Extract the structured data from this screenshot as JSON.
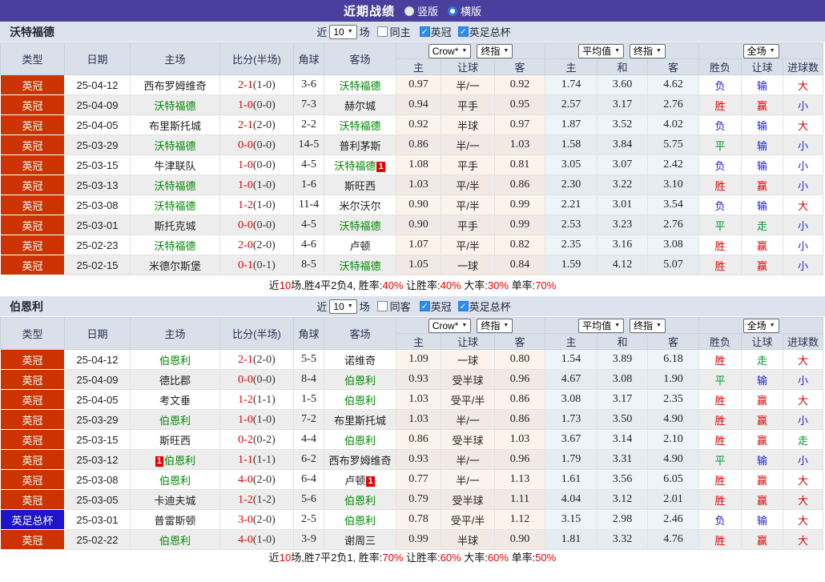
{
  "topbar": {
    "title": "近期战绩",
    "radio_vertical": "竖版",
    "radio_horizontal": "横版"
  },
  "head": {
    "cols": [
      "类型",
      "日期",
      "主场",
      "比分(半场)",
      "角球",
      "客场"
    ],
    "selects": {
      "book": "Crow*",
      "final_a": "终指",
      "avg": "平均值",
      "final_b": "终指",
      "scope": "全场"
    },
    "sub": [
      "主",
      "让球",
      "客",
      "主",
      "和",
      "客",
      "胜负",
      "让球",
      "进球数"
    ]
  },
  "type_colors": {
    "英冠": "#cc3300",
    "英足总杯": "#1f14cc"
  },
  "result_colors": {
    "胜": "#e60000",
    "赢": "#e60000",
    "大": "#e60000",
    "负": "#2222cc",
    "输": "#2222cc",
    "小": "#2222cc",
    "平": "#009933",
    "走": "#009933"
  },
  "colors": {
    "topbar_bg": "#4a3f9d",
    "section_bg": "#dce3ee",
    "header_bg": "#d9e0ea",
    "team_green": "#008800",
    "score_red": "#e60000",
    "badge_red": "#e60000",
    "check_blue": "#2b8ced"
  },
  "sections": [
    {
      "team": "沃特福德",
      "filter": {
        "near": "近",
        "count": "10",
        "games": "场",
        "same": {
          "label": "同主",
          "checked": false
        },
        "checks": [
          {
            "label": "英冠",
            "checked": true
          },
          {
            "label": "英足总杯",
            "checked": true
          }
        ]
      },
      "rows": [
        {
          "type": "英冠",
          "date": "25-04-12",
          "home": "西布罗姆维奇",
          "home_badge": "",
          "score": "2-1",
          "half": "(1-0)",
          "corner": "3-6",
          "away": "沃特福德",
          "away_badge": "",
          "odds": [
            "0.97",
            "半/一",
            "0.92"
          ],
          "avg": [
            "1.74",
            "3.60",
            "4.62"
          ],
          "result": [
            "负",
            "输",
            "大"
          ]
        },
        {
          "type": "英冠",
          "date": "25-04-09",
          "home": "沃特福德",
          "home_badge": "",
          "score": "1-0",
          "half": "(0-0)",
          "corner": "7-3",
          "away": "赫尔城",
          "away_badge": "",
          "odds": [
            "0.94",
            "平手",
            "0.95"
          ],
          "avg": [
            "2.57",
            "3.17",
            "2.76"
          ],
          "result": [
            "胜",
            "赢",
            "小"
          ]
        },
        {
          "type": "英冠",
          "date": "25-04-05",
          "home": "布里斯托城",
          "home_badge": "",
          "score": "2-1",
          "half": "(2-0)",
          "corner": "2-2",
          "away": "沃特福德",
          "away_badge": "",
          "odds": [
            "0.92",
            "半球",
            "0.97"
          ],
          "avg": [
            "1.87",
            "3.52",
            "4.02"
          ],
          "result": [
            "负",
            "输",
            "大"
          ]
        },
        {
          "type": "英冠",
          "date": "25-03-29",
          "home": "沃特福德",
          "home_badge": "",
          "score": "0-0",
          "half": "(0-0)",
          "corner": "14-5",
          "away": "普利茅斯",
          "away_badge": "",
          "odds": [
            "0.86",
            "半/一",
            "1.03"
          ],
          "avg": [
            "1.58",
            "3.84",
            "5.75"
          ],
          "result": [
            "平",
            "输",
            "小"
          ]
        },
        {
          "type": "英冠",
          "date": "25-03-15",
          "home": "牛津联队",
          "home_badge": "",
          "score": "1-0",
          "half": "(0-0)",
          "corner": "4-5",
          "away": "沃特福德",
          "away_badge": "1",
          "odds": [
            "1.08",
            "平手",
            "0.81"
          ],
          "avg": [
            "3.05",
            "3.07",
            "2.42"
          ],
          "result": [
            "负",
            "输",
            "小"
          ]
        },
        {
          "type": "英冠",
          "date": "25-03-13",
          "home": "沃特福德",
          "home_badge": "",
          "score": "1-0",
          "half": "(1-0)",
          "corner": "1-6",
          "away": "斯旺西",
          "away_badge": "",
          "odds": [
            "1.03",
            "平/半",
            "0.86"
          ],
          "avg": [
            "2.30",
            "3.22",
            "3.10"
          ],
          "result": [
            "胜",
            "赢",
            "小"
          ]
        },
        {
          "type": "英冠",
          "date": "25-03-08",
          "home": "沃特福德",
          "home_badge": "",
          "score": "1-2",
          "half": "(1-0)",
          "corner": "11-4",
          "away": "米尔沃尔",
          "away_badge": "",
          "odds": [
            "0.90",
            "平/半",
            "0.99"
          ],
          "avg": [
            "2.21",
            "3.01",
            "3.54"
          ],
          "result": [
            "负",
            "输",
            "大"
          ]
        },
        {
          "type": "英冠",
          "date": "25-03-01",
          "home": "斯托克城",
          "home_badge": "",
          "score": "0-0",
          "half": "(0-0)",
          "corner": "4-5",
          "away": "沃特福德",
          "away_badge": "",
          "odds": [
            "0.90",
            "平手",
            "0.99"
          ],
          "avg": [
            "2.53",
            "3.23",
            "2.76"
          ],
          "result": [
            "平",
            "走",
            "小"
          ]
        },
        {
          "type": "英冠",
          "date": "25-02-23",
          "home": "沃特福德",
          "home_badge": "",
          "score": "2-0",
          "half": "(2-0)",
          "corner": "4-6",
          "away": "卢顿",
          "away_badge": "",
          "odds": [
            "1.07",
            "平/半",
            "0.82"
          ],
          "avg": [
            "2.35",
            "3.16",
            "3.08"
          ],
          "result": [
            "胜",
            "赢",
            "小"
          ]
        },
        {
          "type": "英冠",
          "date": "25-02-15",
          "home": "米德尔斯堡",
          "home_badge": "",
          "score": "0-1",
          "half": "(0-1)",
          "corner": "8-5",
          "away": "沃特福德",
          "away_badge": "",
          "odds": [
            "1.05",
            "一球",
            "0.84"
          ],
          "avg": [
            "1.59",
            "4.12",
            "5.07"
          ],
          "result": [
            "胜",
            "赢",
            "小"
          ]
        }
      ],
      "summary": [
        {
          "t": "近"
        },
        {
          "t": "10",
          "red": true
        },
        {
          "t": "场,胜4平2负4, 胜率:"
        },
        {
          "t": "40%",
          "red": true
        },
        {
          "t": " 让胜率:"
        },
        {
          "t": "40%",
          "red": true
        },
        {
          "t": " 大率:"
        },
        {
          "t": "30%",
          "red": true
        },
        {
          "t": " 单率:"
        },
        {
          "t": "70%",
          "red": true
        }
      ]
    },
    {
      "team": "伯恩利",
      "filter": {
        "near": "近",
        "count": "10",
        "games": "场",
        "same": {
          "label": "同客",
          "checked": false
        },
        "checks": [
          {
            "label": "英冠",
            "checked": true
          },
          {
            "label": "英足总杯",
            "checked": true
          }
        ]
      },
      "rows": [
        {
          "type": "英冠",
          "date": "25-04-12",
          "home": "伯恩利",
          "home_badge": "",
          "score": "2-1",
          "half": "(2-0)",
          "corner": "5-5",
          "away": "诺维奇",
          "away_badge": "",
          "odds": [
            "1.09",
            "一球",
            "0.80"
          ],
          "avg": [
            "1.54",
            "3.89",
            "6.18"
          ],
          "result": [
            "胜",
            "走",
            "大"
          ]
        },
        {
          "type": "英冠",
          "date": "25-04-09",
          "home": "德比郡",
          "home_badge": "",
          "score": "0-0",
          "half": "(0-0)",
          "corner": "8-4",
          "away": "伯恩利",
          "away_badge": "",
          "odds": [
            "0.93",
            "受半球",
            "0.96"
          ],
          "avg": [
            "4.67",
            "3.08",
            "1.90"
          ],
          "result": [
            "平",
            "输",
            "小"
          ]
        },
        {
          "type": "英冠",
          "date": "25-04-05",
          "home": "考文垂",
          "home_badge": "",
          "score": "1-2",
          "half": "(1-1)",
          "corner": "1-5",
          "away": "伯恩利",
          "away_badge": "",
          "odds": [
            "1.03",
            "受平/半",
            "0.86"
          ],
          "avg": [
            "3.08",
            "3.17",
            "2.35"
          ],
          "result": [
            "胜",
            "赢",
            "大"
          ]
        },
        {
          "type": "英冠",
          "date": "25-03-29",
          "home": "伯恩利",
          "home_badge": "",
          "score": "1-0",
          "half": "(1-0)",
          "corner": "7-2",
          "away": "布里斯托城",
          "away_badge": "",
          "odds": [
            "1.03",
            "半/一",
            "0.86"
          ],
          "avg": [
            "1.73",
            "3.50",
            "4.90"
          ],
          "result": [
            "胜",
            "赢",
            "小"
          ]
        },
        {
          "type": "英冠",
          "date": "25-03-15",
          "home": "斯旺西",
          "home_badge": "",
          "score": "0-2",
          "half": "(0-2)",
          "corner": "4-4",
          "away": "伯恩利",
          "away_badge": "",
          "odds": [
            "0.86",
            "受半球",
            "1.03"
          ],
          "avg": [
            "3.67",
            "3.14",
            "2.10"
          ],
          "result": [
            "胜",
            "赢",
            "走"
          ]
        },
        {
          "type": "英冠",
          "date": "25-03-12",
          "home": "伯恩利",
          "home_badge": "1",
          "score": "1-1",
          "half": "(1-1)",
          "corner": "6-2",
          "away": "西布罗姆维奇",
          "away_badge": "",
          "odds": [
            "0.93",
            "半/一",
            "0.96"
          ],
          "avg": [
            "1.79",
            "3.31",
            "4.90"
          ],
          "result": [
            "平",
            "输",
            "小"
          ]
        },
        {
          "type": "英冠",
          "date": "25-03-08",
          "home": "伯恩利",
          "home_badge": "",
          "score": "4-0",
          "half": "(2-0)",
          "corner": "6-4",
          "away": "卢顿",
          "away_badge": "1",
          "odds": [
            "0.77",
            "半/一",
            "1.13"
          ],
          "avg": [
            "1.61",
            "3.56",
            "6.05"
          ],
          "result": [
            "胜",
            "赢",
            "大"
          ]
        },
        {
          "type": "英冠",
          "date": "25-03-05",
          "home": "卡迪夫城",
          "home_badge": "",
          "score": "1-2",
          "half": "(1-2)",
          "corner": "5-6",
          "away": "伯恩利",
          "away_badge": "",
          "odds": [
            "0.79",
            "受半球",
            "1.11"
          ],
          "avg": [
            "4.04",
            "3.12",
            "2.01"
          ],
          "result": [
            "胜",
            "赢",
            "大"
          ]
        },
        {
          "type": "英足总杯",
          "date": "25-03-01",
          "home": "普雷斯顿",
          "home_badge": "",
          "score": "3-0",
          "half": "(2-0)",
          "corner": "2-5",
          "away": "伯恩利",
          "away_badge": "",
          "odds": [
            "0.78",
            "受平/半",
            "1.12"
          ],
          "avg": [
            "3.15",
            "2.98",
            "2.46"
          ],
          "result": [
            "负",
            "输",
            "大"
          ]
        },
        {
          "type": "英冠",
          "date": "25-02-22",
          "home": "伯恩利",
          "home_badge": "",
          "score": "4-0",
          "half": "(1-0)",
          "corner": "3-9",
          "away": "谢周三",
          "away_badge": "",
          "odds": [
            "0.99",
            "半球",
            "0.90"
          ],
          "avg": [
            "1.81",
            "3.32",
            "4.76"
          ],
          "result": [
            "胜",
            "赢",
            "大"
          ]
        }
      ],
      "summary": [
        {
          "t": "近"
        },
        {
          "t": "10",
          "red": true
        },
        {
          "t": "场,胜7平2负1, 胜率:"
        },
        {
          "t": "70%",
          "red": true
        },
        {
          "t": " 让胜率:"
        },
        {
          "t": "60%",
          "red": true
        },
        {
          "t": " 大率:"
        },
        {
          "t": "60%",
          "red": true
        },
        {
          "t": " 单率:"
        },
        {
          "t": "50%",
          "red": true
        }
      ]
    }
  ]
}
